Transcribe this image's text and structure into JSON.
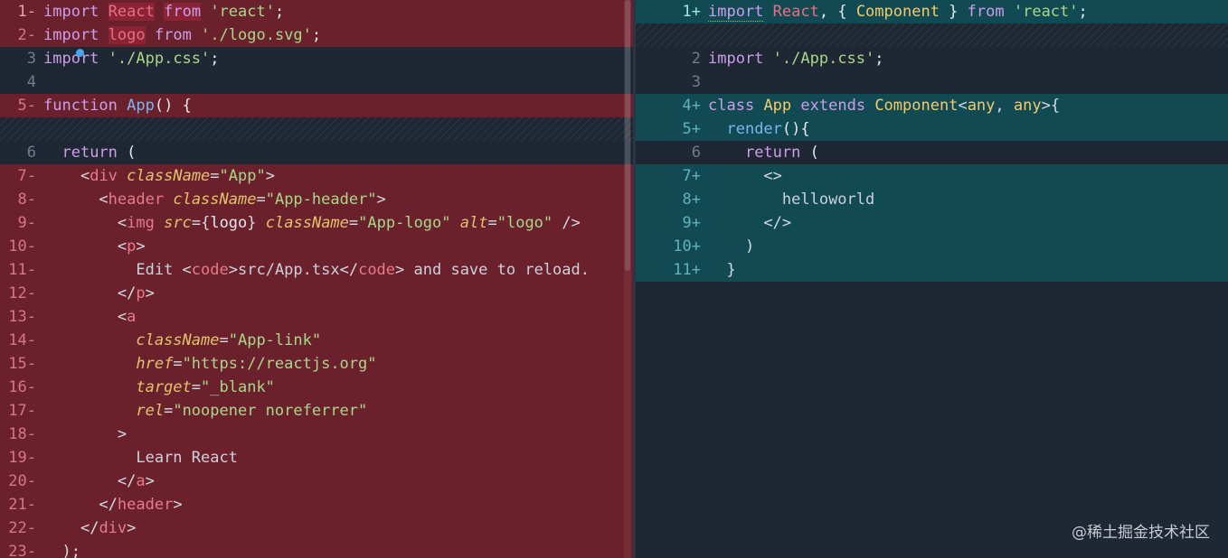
{
  "left": {
    "lines": [
      {
        "num": "1",
        "mark": "-",
        "type": "del",
        "tokens": [
          [
            "kw",
            "import"
          ],
          [
            "plain",
            " "
          ],
          [
            "hl",
            "React"
          ],
          [
            "plain",
            " "
          ],
          [
            "hl-kw",
            "from"
          ],
          [
            "plain",
            " "
          ],
          [
            "str",
            "'react'"
          ],
          [
            "plain",
            ";"
          ]
        ]
      },
      {
        "num": "2",
        "mark": "-",
        "type": "del",
        "tokens": [
          [
            "kw",
            "import"
          ],
          [
            "plain",
            " "
          ],
          [
            "hl",
            "logo"
          ],
          [
            "plain",
            " "
          ],
          [
            "kw",
            "from"
          ],
          [
            "plain",
            " "
          ],
          [
            "str",
            "'./logo.svg'"
          ],
          [
            "plain",
            ";"
          ]
        ]
      },
      {
        "num": "3",
        "mark": "",
        "type": "ctx",
        "tokens": [
          [
            "kw",
            "import"
          ],
          [
            "plain",
            " "
          ],
          [
            "str",
            "'./App.css'"
          ],
          [
            "plain",
            ";"
          ]
        ]
      },
      {
        "num": "4",
        "mark": "",
        "type": "ctx",
        "tokens": []
      },
      {
        "num": "5",
        "mark": "-",
        "type": "del",
        "tokens": [
          [
            "kw",
            "function"
          ],
          [
            "plain",
            " "
          ],
          [
            "fn",
            "App"
          ],
          [
            "plain",
            "() {"
          ]
        ]
      },
      {
        "num": "",
        "mark": "",
        "type": "hatch",
        "tokens": []
      },
      {
        "num": "6",
        "mark": "",
        "type": "ctx",
        "tokens": [
          [
            "plain",
            "  "
          ],
          [
            "kw",
            "return"
          ],
          [
            "plain",
            " ("
          ]
        ]
      },
      {
        "num": "7",
        "mark": "-",
        "type": "del",
        "tokens": [
          [
            "plain",
            "    "
          ],
          [
            "punc",
            "<"
          ],
          [
            "tag",
            "div"
          ],
          [
            "plain",
            " "
          ],
          [
            "attr",
            "className"
          ],
          [
            "punc",
            "="
          ],
          [
            "str",
            "\"App\""
          ],
          [
            "punc",
            ">"
          ]
        ]
      },
      {
        "num": "8",
        "mark": "-",
        "type": "del",
        "tokens": [
          [
            "plain",
            "      "
          ],
          [
            "punc",
            "<"
          ],
          [
            "tag",
            "header"
          ],
          [
            "plain",
            " "
          ],
          [
            "attr",
            "className"
          ],
          [
            "punc",
            "="
          ],
          [
            "str",
            "\"App-header\""
          ],
          [
            "punc",
            ">"
          ]
        ]
      },
      {
        "num": "9",
        "mark": "-",
        "type": "del",
        "tokens": [
          [
            "plain",
            "        "
          ],
          [
            "punc",
            "<"
          ],
          [
            "tag",
            "img"
          ],
          [
            "plain",
            " "
          ],
          [
            "attr",
            "src"
          ],
          [
            "punc",
            "="
          ],
          [
            "punc",
            "{"
          ],
          [
            "var",
            "logo"
          ],
          [
            "punc",
            "}"
          ],
          [
            "plain",
            " "
          ],
          [
            "attr",
            "className"
          ],
          [
            "punc",
            "="
          ],
          [
            "str",
            "\"App-logo\""
          ],
          [
            "plain",
            " "
          ],
          [
            "attr",
            "alt"
          ],
          [
            "punc",
            "="
          ],
          [
            "str",
            "\"logo\""
          ],
          [
            "plain",
            " "
          ],
          [
            "punc",
            "/>"
          ]
        ]
      },
      {
        "num": "10",
        "mark": "-",
        "type": "del",
        "tokens": [
          [
            "plain",
            "        "
          ],
          [
            "punc",
            "<"
          ],
          [
            "tag",
            "p"
          ],
          [
            "punc",
            ">"
          ]
        ]
      },
      {
        "num": "11",
        "mark": "-",
        "type": "del",
        "tokens": [
          [
            "plain",
            "          "
          ],
          [
            "jsx",
            "Edit "
          ],
          [
            "punc",
            "<"
          ],
          [
            "tag",
            "code"
          ],
          [
            "punc",
            ">"
          ],
          [
            "jsx",
            "src/App.tsx"
          ],
          [
            "punc",
            "</"
          ],
          [
            "tag",
            "code"
          ],
          [
            "punc",
            ">"
          ],
          [
            "jsx",
            " and save to reload."
          ]
        ]
      },
      {
        "num": "12",
        "mark": "-",
        "type": "del",
        "tokens": [
          [
            "plain",
            "        "
          ],
          [
            "punc",
            "</"
          ],
          [
            "tag",
            "p"
          ],
          [
            "punc",
            ">"
          ]
        ]
      },
      {
        "num": "13",
        "mark": "-",
        "type": "del",
        "tokens": [
          [
            "plain",
            "        "
          ],
          [
            "punc",
            "<"
          ],
          [
            "tag",
            "a"
          ]
        ]
      },
      {
        "num": "14",
        "mark": "-",
        "type": "del",
        "tokens": [
          [
            "plain",
            "          "
          ],
          [
            "attr",
            "className"
          ],
          [
            "punc",
            "="
          ],
          [
            "str",
            "\"App-link\""
          ]
        ]
      },
      {
        "num": "15",
        "mark": "-",
        "type": "del",
        "tokens": [
          [
            "plain",
            "          "
          ],
          [
            "attr",
            "href"
          ],
          [
            "punc",
            "="
          ],
          [
            "str",
            "\"https://reactjs.org\""
          ]
        ]
      },
      {
        "num": "16",
        "mark": "-",
        "type": "del",
        "tokens": [
          [
            "plain",
            "          "
          ],
          [
            "attr",
            "target"
          ],
          [
            "punc",
            "="
          ],
          [
            "str",
            "\"_blank\""
          ]
        ]
      },
      {
        "num": "17",
        "mark": "-",
        "type": "del",
        "tokens": [
          [
            "plain",
            "          "
          ],
          [
            "attr",
            "rel"
          ],
          [
            "punc",
            "="
          ],
          [
            "str",
            "\"noopener noreferrer\""
          ]
        ]
      },
      {
        "num": "18",
        "mark": "-",
        "type": "del",
        "tokens": [
          [
            "plain",
            "        "
          ],
          [
            "punc",
            ">"
          ]
        ]
      },
      {
        "num": "19",
        "mark": "-",
        "type": "del",
        "tokens": [
          [
            "plain",
            "          "
          ],
          [
            "jsx",
            "Learn React"
          ]
        ]
      },
      {
        "num": "20",
        "mark": "-",
        "type": "del",
        "tokens": [
          [
            "plain",
            "        "
          ],
          [
            "punc",
            "</"
          ],
          [
            "tag",
            "a"
          ],
          [
            "punc",
            ">"
          ]
        ]
      },
      {
        "num": "21",
        "mark": "-",
        "type": "del",
        "tokens": [
          [
            "plain",
            "      "
          ],
          [
            "punc",
            "</"
          ],
          [
            "tag",
            "header"
          ],
          [
            "punc",
            ">"
          ]
        ]
      },
      {
        "num": "22",
        "mark": "-",
        "type": "del",
        "tokens": [
          [
            "plain",
            "    "
          ],
          [
            "punc",
            "</"
          ],
          [
            "tag",
            "div"
          ],
          [
            "punc",
            ">"
          ]
        ]
      },
      {
        "num": "23",
        "mark": "-",
        "type": "del",
        "tokens": [
          [
            "plain",
            "  "
          ],
          [
            "punc",
            ");"
          ]
        ]
      }
    ]
  },
  "right": {
    "lines": [
      {
        "num": "1",
        "mark": "+",
        "type": "add",
        "tokens": [
          [
            "kw-sq",
            "import"
          ],
          [
            "plain",
            " "
          ],
          [
            "hl-red",
            "React"
          ],
          [
            "plain",
            ", { "
          ],
          [
            "cls",
            "Component"
          ],
          [
            "plain",
            " } "
          ],
          [
            "kw",
            "from"
          ],
          [
            "plain",
            " "
          ],
          [
            "str",
            "'react'"
          ],
          [
            "plain",
            ";"
          ]
        ]
      },
      {
        "num": "",
        "mark": "",
        "type": "hatch",
        "tokens": []
      },
      {
        "num": "2",
        "mark": "",
        "type": "ctx",
        "tokens": [
          [
            "kw",
            "import"
          ],
          [
            "plain",
            " "
          ],
          [
            "str",
            "'./App.css'"
          ],
          [
            "plain",
            ";"
          ]
        ]
      },
      {
        "num": "3",
        "mark": "",
        "type": "ctx",
        "tokens": []
      },
      {
        "num": "4",
        "mark": "+",
        "type": "add",
        "tokens": [
          [
            "kw",
            "class"
          ],
          [
            "plain",
            " "
          ],
          [
            "cls",
            "App"
          ],
          [
            "plain",
            " "
          ],
          [
            "kw",
            "extends"
          ],
          [
            "plain",
            " "
          ],
          [
            "cls",
            "Component"
          ],
          [
            "punc",
            "<"
          ],
          [
            "cls",
            "any"
          ],
          [
            "punc",
            ", "
          ],
          [
            "cls",
            "any"
          ],
          [
            "punc",
            ">{"
          ]
        ]
      },
      {
        "num": "5",
        "mark": "+",
        "type": "add",
        "tokens": [
          [
            "plain",
            "  "
          ],
          [
            "fn",
            "render"
          ],
          [
            "plain",
            "(){"
          ]
        ]
      },
      {
        "num": "6",
        "mark": "",
        "type": "ctx",
        "tokens": [
          [
            "plain",
            "    "
          ],
          [
            "kw",
            "return"
          ],
          [
            "plain",
            " ("
          ]
        ]
      },
      {
        "num": "7",
        "mark": "+",
        "type": "add",
        "tokens": [
          [
            "plain",
            "      "
          ],
          [
            "punc",
            "<>"
          ]
        ]
      },
      {
        "num": "8",
        "mark": "+",
        "type": "add",
        "tokens": [
          [
            "plain",
            "        "
          ],
          [
            "jsx",
            "helloworld"
          ]
        ]
      },
      {
        "num": "9",
        "mark": "+",
        "type": "add",
        "tokens": [
          [
            "plain",
            "      "
          ],
          [
            "punc",
            "</>"
          ]
        ]
      },
      {
        "num": "10",
        "mark": "+",
        "type": "add",
        "tokens": [
          [
            "plain",
            "    "
          ],
          [
            "punc",
            ")"
          ]
        ]
      },
      {
        "num": "11",
        "mark": "+",
        "type": "add",
        "tokens": [
          [
            "plain",
            "  "
          ],
          [
            "punc",
            "}"
          ]
        ]
      }
    ]
  },
  "watermark": "@稀土掘金技术社区"
}
